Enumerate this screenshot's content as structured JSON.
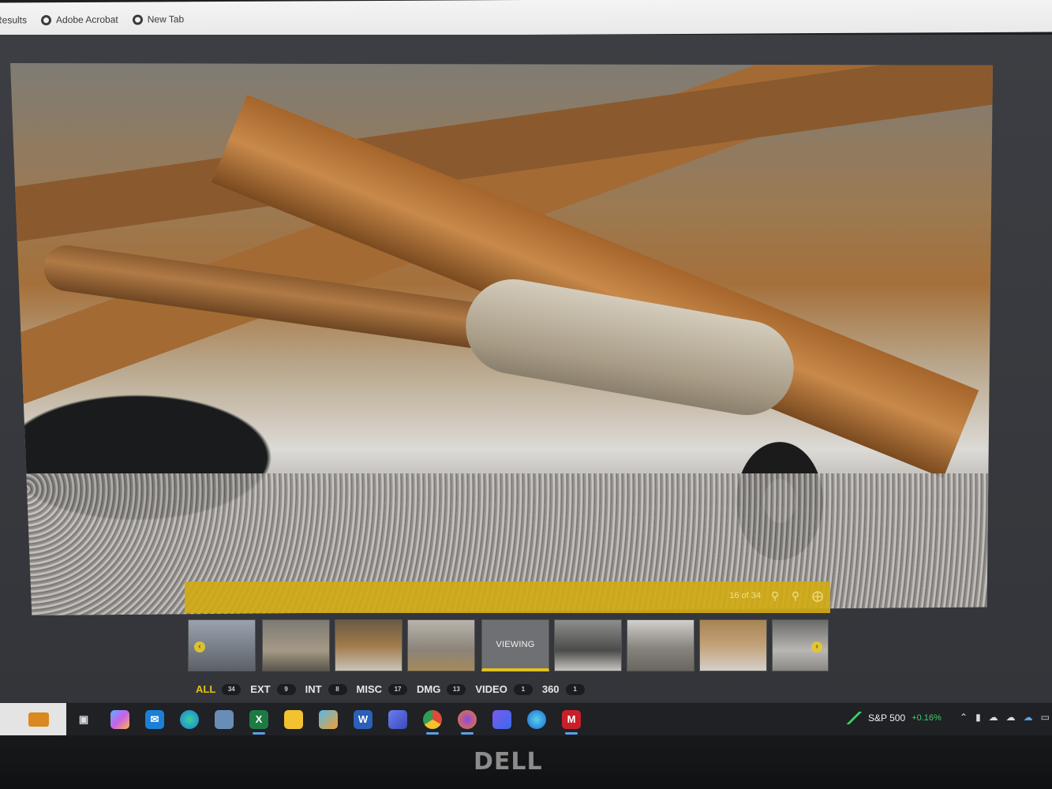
{
  "bookmarks": {
    "items": [
      {
        "label": "Results"
      },
      {
        "label": "Adobe Acrobat",
        "icon": "globe-icon"
      },
      {
        "label": "New Tab",
        "icon": "globe-icon"
      }
    ]
  },
  "viewer": {
    "photo_description_icon": "vehicle-undercarriage-photo",
    "counter": "16 of 34",
    "toolbar_icons": [
      "zoom-in-icon",
      "zoom-out-icon",
      "fullscreen-icon"
    ],
    "accent_color": "#e1c21c",
    "thumbnails": [
      {
        "type": "image",
        "icon": "vehicle-photo-thumbnail"
      },
      {
        "type": "image",
        "icon": "vehicle-photo-thumbnail"
      },
      {
        "type": "image",
        "icon": "vehicle-photo-thumbnail"
      },
      {
        "type": "image",
        "icon": "vehicle-photo-thumbnail"
      },
      {
        "type": "viewing",
        "label": "VIEWING"
      },
      {
        "type": "image",
        "icon": "vehicle-photo-thumbnail"
      },
      {
        "type": "image",
        "icon": "vehicle-photo-thumbnail"
      },
      {
        "type": "image",
        "icon": "vehicle-photo-thumbnail"
      },
      {
        "type": "image",
        "icon": "vehicle-photo-thumbnail"
      }
    ]
  },
  "categories": [
    {
      "label": "ALL",
      "count": "34",
      "active": true
    },
    {
      "label": "EXT",
      "count": "9"
    },
    {
      "label": "INT",
      "count": "8"
    },
    {
      "label": "MISC",
      "count": "17"
    },
    {
      "label": "DMG",
      "count": "13"
    },
    {
      "label": "VIDEO",
      "count": "1"
    },
    {
      "label": "360",
      "count": "1"
    }
  ],
  "taskbar": {
    "icons": [
      "briefcase-icon",
      "task-view-icon",
      "copilot-icon",
      "mail-icon",
      "edge-icon",
      "remote-desktop-icon",
      "excel-icon",
      "file-explorer-icon",
      "paint-icon",
      "word-icon",
      "app-icon",
      "chrome-icon",
      "firefox-icon",
      "app-icon-2",
      "edge-beta-icon",
      "mcafee-icon"
    ],
    "stock": {
      "name": "S&P 500",
      "change": "+0.16%"
    },
    "tray_icons": [
      "chevron-up-icon",
      "battery-icon",
      "cloud-icon",
      "cloud-icon-2",
      "onedrive-icon",
      "display-icon"
    ]
  },
  "monitor": {
    "brand": "DELL"
  }
}
